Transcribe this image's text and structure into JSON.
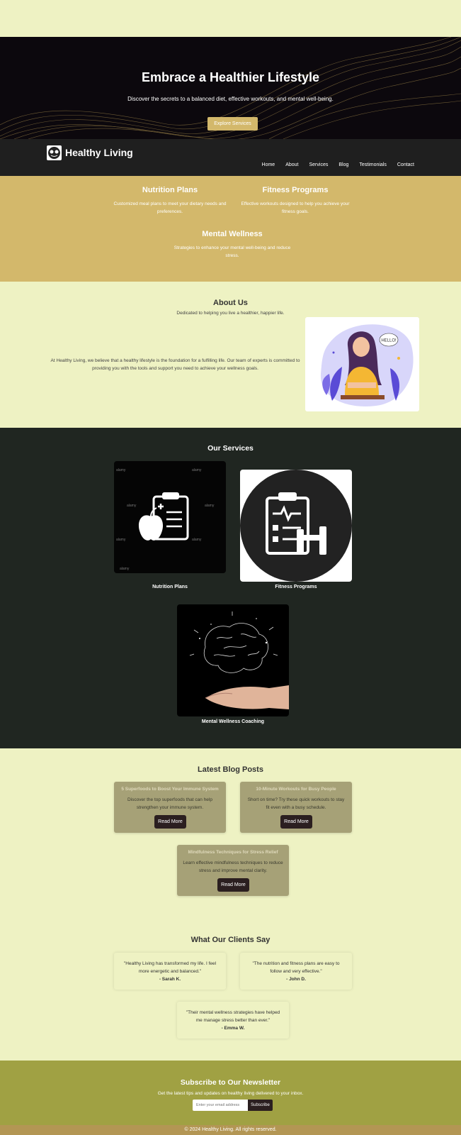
{
  "hero": {
    "title": "Embrace a Healthier Lifestyle",
    "subtitle": "Discover the secrets to a balanced diet, effective workouts, and mental well-being.",
    "cta": "Explore Services"
  },
  "header": {
    "brand": "Healthy Living",
    "nav": [
      "Home",
      "About",
      "Services",
      "Blog",
      "Testimonials",
      "Contact"
    ]
  },
  "features": [
    {
      "title": "Nutrition Plans",
      "text": "Customized meal plans to meet your dietary needs and preferences."
    },
    {
      "title": "Fitness Programs",
      "text": "Effective workouts designed to help you achieve your fitness goals."
    },
    {
      "title": "Mental Wellness",
      "text": "Strategies to enhance your mental well-being and reduce stress."
    }
  ],
  "about": {
    "title": "About Us",
    "subtitle": "Dedicated to helping you live a healthier, happier life.",
    "text": "At Healthy Living, we believe that a healthy lifestyle is the foundation for a fulfilling life. Our team of experts is committed to providing you with the tools and support you need to achieve your wellness goals.",
    "image_bubble": "HELLO!"
  },
  "services": {
    "title": "Our Services",
    "items": [
      {
        "caption": "Nutrition Plans",
        "icon": "clipboard-apple-icon"
      },
      {
        "caption": "Fitness Programs",
        "icon": "clipboard-dumbbell-icon"
      },
      {
        "caption": "Mental Wellness Coaching",
        "icon": "brain-hand-icon"
      }
    ],
    "watermark": "alamy"
  },
  "blog": {
    "title": "Latest Blog Posts",
    "posts": [
      {
        "title": "5 Superfoods to Boost Your Immune System",
        "excerpt": "Discover the top superfoods that can help strengthen your immune system.",
        "button": "Read More"
      },
      {
        "title": "10-Minute Workouts for Busy People",
        "excerpt": "Short on time? Try these quick workouts to stay fit even with a busy schedule.",
        "button": "Read More"
      },
      {
        "title": "Mindfulness Techniques for Stress Relief",
        "excerpt": "Learn effective mindfulness techniques to reduce stress and improve mental clarity.",
        "button": "Read More"
      }
    ]
  },
  "testimonials": {
    "title": "What Our Clients Say",
    "items": [
      {
        "quote": "\"Healthy Living has transformed my life. I feel more energetic and balanced.\"",
        "author": "- Sarah K."
      },
      {
        "quote": "\"The nutrition and fitness plans are easy to follow and very effective.\"",
        "author": "- John D."
      },
      {
        "quote": "\"Their mental wellness strategies have helped me manage stress better than ever.\"",
        "author": "- Emma W."
      }
    ]
  },
  "newsletter": {
    "title": "Subscribe to Our Newsletter",
    "subtitle": "Get the latest tips and updates on healthy living delivered to your inbox.",
    "placeholder": "Enter your email address",
    "button": "Subscribe"
  },
  "footer": {
    "text": "© 2024 Healthy Living. All rights reserved."
  },
  "colors": {
    "page_bg": "#eef2c3",
    "hero_bg": "#0c080d",
    "accent_gold": "#d3b86b",
    "header_bg": "#1f1f1f",
    "services_bg": "#202621",
    "blog_card": "#a6a177",
    "newsletter_bg": "#a0a143",
    "footer_bg": "#b39654"
  }
}
